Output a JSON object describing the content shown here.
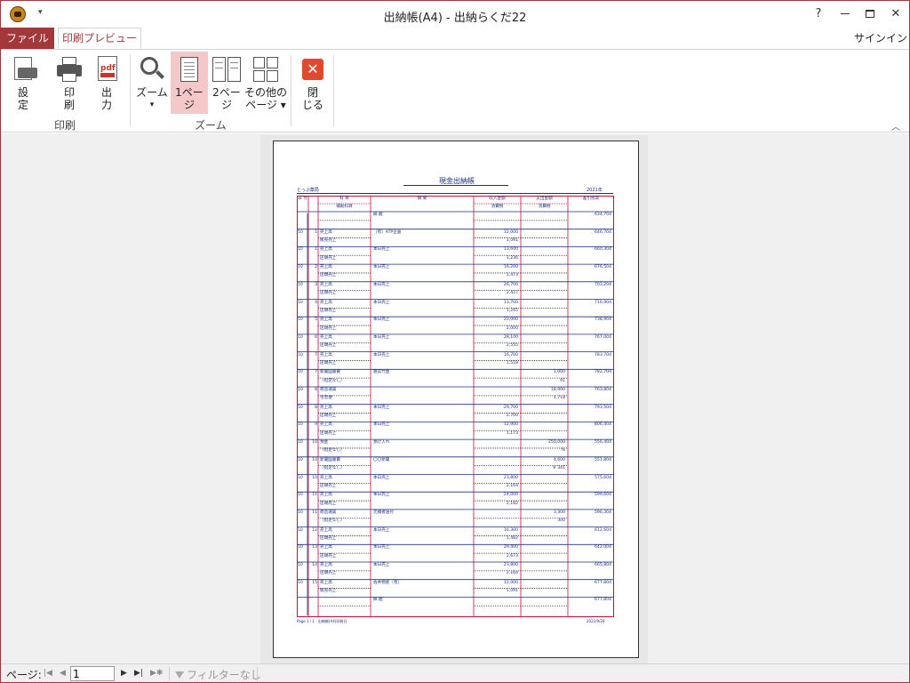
{
  "window": {
    "title": "出納帳(A4) - 出納らくだ22",
    "help": "?",
    "restore": "🗗",
    "minimize": "—",
    "maximize": "☐",
    "close": "✕",
    "qa_dropdown": "▾"
  },
  "tabs": {
    "file": "ファイル",
    "preview": "印刷プレビュー",
    "signin": "サインイン"
  },
  "ribbon": {
    "print_group": {
      "label": "印刷",
      "settings": "設\n定",
      "print": "印\n刷",
      "output": "出\n力"
    },
    "zoom_group": {
      "label": "ズーム",
      "zoom": "ズーム",
      "zoom_caret": "▾",
      "one_page": "1ペー\nジ",
      "two_page": "2ペー\nジ",
      "other_pages": "その他の\nページ ▾"
    },
    "close_group": {
      "close": "閉\nじる"
    },
    "pdf_label": "pdf",
    "collapse": "︿"
  },
  "document": {
    "title": "現金出納帳",
    "company": "とっぷ薬局",
    "year": "2021年",
    "headers": {
      "date": "日 付",
      "account": "科 目",
      "sub_account": "補助科目",
      "summary": "摘 要",
      "income": "収入金額",
      "income_tax": "消費税",
      "expense": "支出金額",
      "expense_tax": "消費税",
      "balance": "差引残高"
    },
    "rows": [
      {
        "m": "",
        "d": "",
        "account": "",
        "sub": "",
        "summary": "繰 越",
        "income": "",
        "income_tax": "",
        "expense": "",
        "expense_tax": "",
        "balance": "634,704"
      },
      {
        "m": "10",
        "d": "1",
        "account": "売上高",
        "sub": "販売売上",
        "summary": "（有）ATP企画",
        "income": "12,000",
        "income_tax": "1,091",
        "expense": "",
        "expense_tax": "",
        "balance": "646,704"
      },
      {
        "m": "10",
        "d": "1",
        "account": "売上高",
        "sub": "店頭売上",
        "summary": "本日売上",
        "income": "13,600",
        "income_tax": "1,236",
        "expense": "",
        "expense_tax": "",
        "balance": "660,304"
      },
      {
        "m": "10",
        "d": "2",
        "account": "売上高",
        "sub": "店頭売上",
        "summary": "本日売上",
        "income": "16,200",
        "income_tax": "1,473",
        "expense": "",
        "expense_tax": "",
        "balance": "676,504"
      },
      {
        "m": "10",
        "d": "3",
        "account": "売上高",
        "sub": "店頭売上",
        "summary": "本日売上",
        "income": "26,700",
        "income_tax": "2,427",
        "expense": "",
        "expense_tax": "",
        "balance": "703,204"
      },
      {
        "m": "10",
        "d": "4",
        "account": "売上高",
        "sub": "店頭売上",
        "summary": "本日売上",
        "income": "13,700",
        "income_tax": "1,245",
        "expense": "",
        "expense_tax": "",
        "balance": "716,904"
      },
      {
        "m": "10",
        "d": "5",
        "account": "売上高",
        "sub": "店頭売上",
        "summary": "本日売上",
        "income": "22,000",
        "income_tax": "2,000",
        "expense": "",
        "expense_tax": "",
        "balance": "738,904"
      },
      {
        "m": "10",
        "d": "6",
        "account": "売上高",
        "sub": "店頭売上",
        "summary": "本日売上",
        "income": "28,100",
        "income_tax": "2,555",
        "expense": "",
        "expense_tax": "",
        "balance": "767,004"
      },
      {
        "m": "10",
        "d": "7",
        "account": "売上高",
        "sub": "店頭売上",
        "summary": "本日売上",
        "income": "16,700",
        "income_tax": "1,518",
        "expense": "",
        "expense_tax": "",
        "balance": "783,704"
      },
      {
        "m": "10",
        "d": "7",
        "account": "新聞図書費",
        "sub": "（指定なし）",
        "summary": "雑誌代金",
        "income": "",
        "income_tax": "",
        "expense": "1,000",
        "expense_tax": "91",
        "balance": "782,704"
      },
      {
        "m": "10",
        "d": "8",
        "account": "荷造運賃",
        "sub": "宅急便",
        "summary": "",
        "income": "",
        "income_tax": "",
        "expense": "18,900",
        "expense_tax": "1,718",
        "balance": "763,804"
      },
      {
        "m": "10",
        "d": "8",
        "account": "売上高",
        "sub": "店頭売上",
        "summary": "本日売上",
        "income": "29,700",
        "income_tax": "2,700",
        "expense": "",
        "expense_tax": "",
        "balance": "793,504"
      },
      {
        "m": "10",
        "d": "9",
        "account": "売上高",
        "sub": "店頭売上",
        "summary": "本日売上",
        "income": "12,900",
        "income_tax": "1,173",
        "expense": "",
        "expense_tax": "",
        "balance": "806,404"
      },
      {
        "m": "10",
        "d": "10",
        "account": "預金",
        "sub": "（指定なし）",
        "summary": "預け入れ",
        "income": "",
        "income_tax": "",
        "expense": "250,000",
        "expense_tax": "%",
        "balance": "556,404"
      },
      {
        "m": "10",
        "d": "10",
        "account": "新聞図書費",
        "sub": "（指定なし）",
        "summary": "〇〇新聞",
        "income": "",
        "income_tax": "",
        "expense": "4,600",
        "expense_tax": "※ 341",
        "balance": "551,804"
      },
      {
        "m": "10",
        "d": "10",
        "account": "売上高",
        "sub": "店頭売上",
        "summary": "本日売上",
        "income": "23,800",
        "income_tax": "2,164",
        "expense": "",
        "expense_tax": "",
        "balance": "575,604"
      },
      {
        "m": "10",
        "d": "11",
        "account": "売上高",
        "sub": "店頭売上",
        "summary": "本日売上",
        "income": "24,000",
        "income_tax": "2,182",
        "expense": "",
        "expense_tax": "",
        "balance": "599,604"
      },
      {
        "m": "10",
        "d": "11",
        "account": "荷造運賃",
        "sub": "（指定なし）",
        "summary": "元橋者送付",
        "income": "",
        "income_tax": "",
        "expense": "3,300",
        "expense_tax": "300",
        "balance": "596,304"
      },
      {
        "m": "10",
        "d": "12",
        "account": "売上高",
        "sub": "店頭売上",
        "summary": "本日売上",
        "income": "16,300",
        "income_tax": "1,482",
        "expense": "",
        "expense_tax": "",
        "balance": "612,604"
      },
      {
        "m": "10",
        "d": "13",
        "account": "売上高",
        "sub": "店頭売上",
        "summary": "本日売上",
        "income": "29,400",
        "income_tax": "2,673",
        "expense": "",
        "expense_tax": "",
        "balance": "642,004"
      },
      {
        "m": "10",
        "d": "14",
        "account": "売上高",
        "sub": "店頭売上",
        "summary": "本日売上",
        "income": "23,800",
        "income_tax": "2,164",
        "expense": "",
        "expense_tax": "",
        "balance": "665,804"
      },
      {
        "m": "10",
        "d": "15",
        "account": "売上高",
        "sub": "販売売上",
        "summary": "佐井物産（有）",
        "income": "12,000",
        "income_tax": "1,091",
        "expense": "",
        "expense_tax": "",
        "balance": "677,804"
      },
      {
        "m": "",
        "d": "",
        "account": "",
        "sub": "",
        "summary": "繰 越",
        "income": "",
        "income_tax": "",
        "expense": "",
        "expense_tax": "",
        "balance": "677,804"
      }
    ],
    "footer_left": "Page 1 / 1　出納帳(A4)印刷日",
    "footer_right": "2021/9/28"
  },
  "statusbar": {
    "page_label": "ページ:",
    "first": "|◀",
    "prev": "◀",
    "page_value": "1",
    "next": "▶",
    "last": "▶|",
    "new": "▶✱",
    "filter": "フィルターなし"
  },
  "colors": {
    "accent": "#a4373a",
    "ledger_red": "#c8102e",
    "ledger_blue": "#1f3080"
  }
}
